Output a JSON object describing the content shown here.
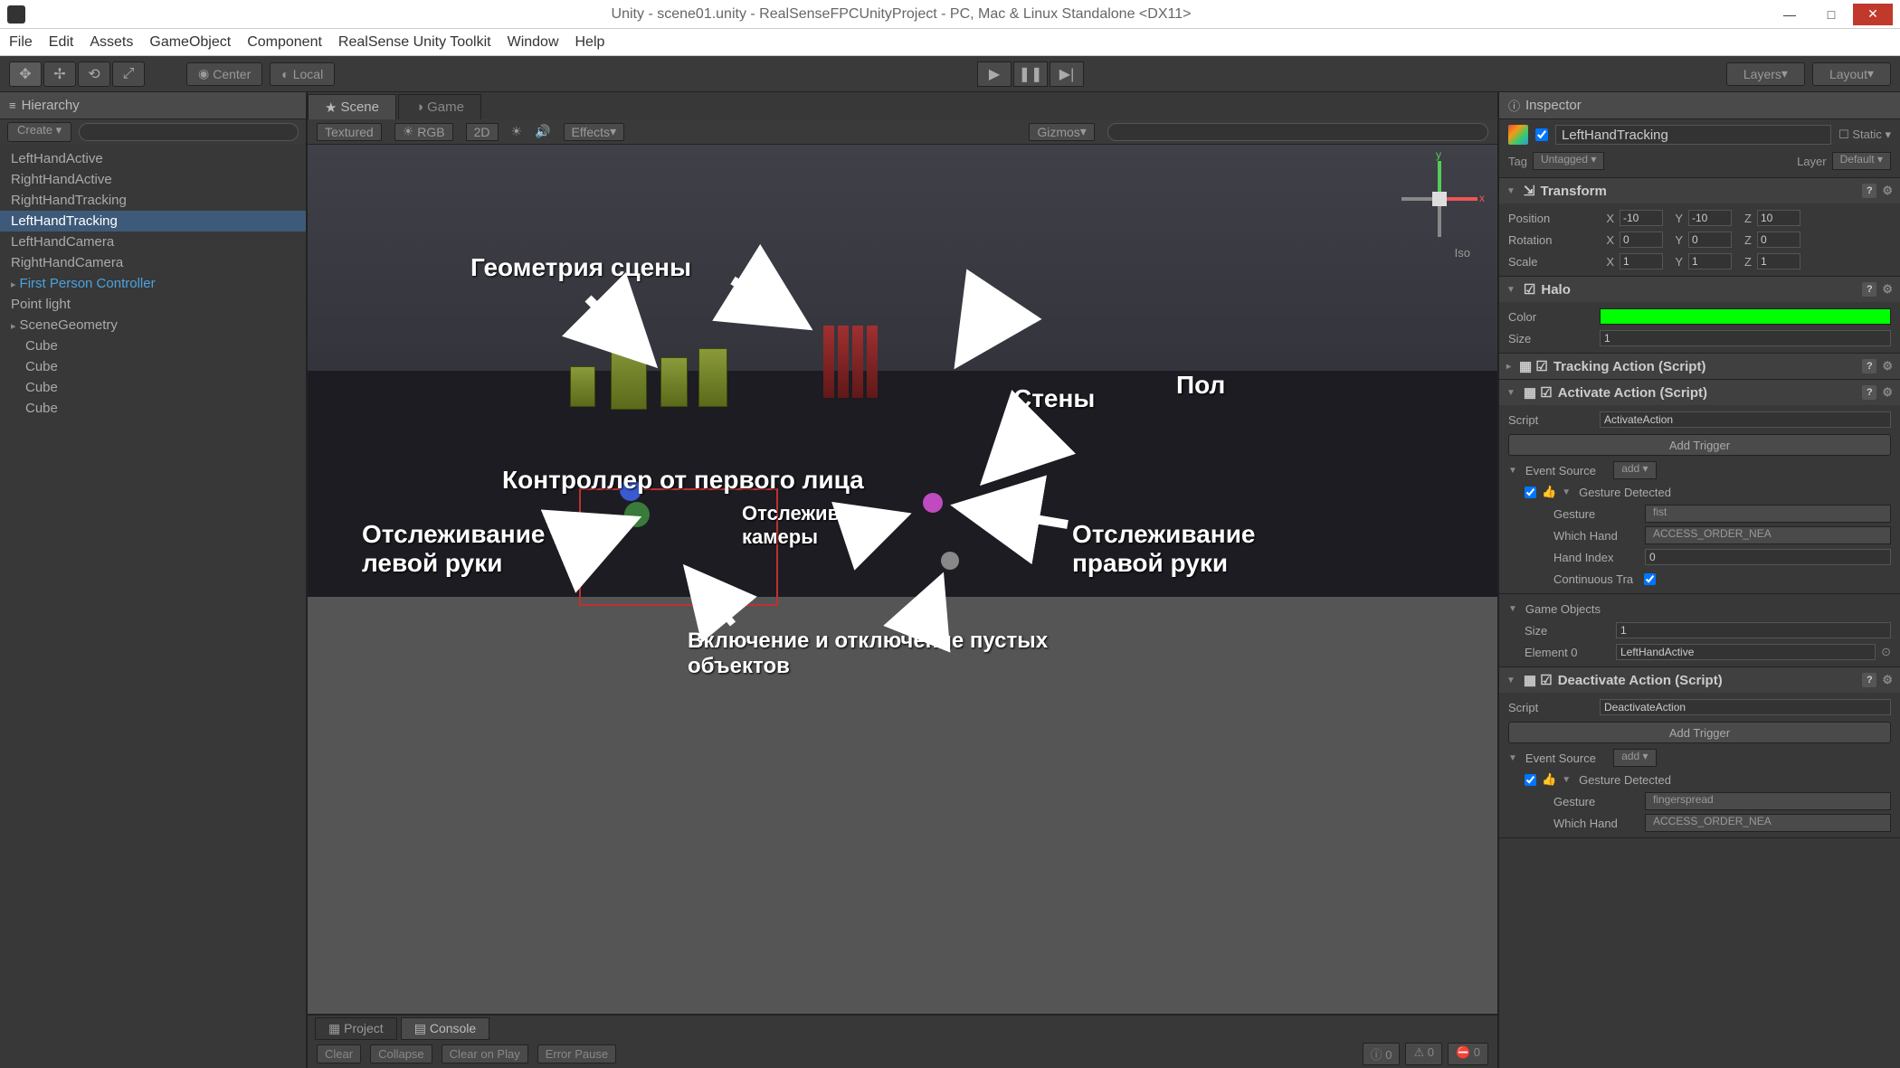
{
  "window": {
    "title": "Unity - scene01.unity - RealSenseFPCUnityProject - PC, Mac & Linux Standalone <DX11>"
  },
  "menubar": [
    "File",
    "Edit",
    "Assets",
    "GameObject",
    "Component",
    "RealSense Unity Toolkit",
    "Window",
    "Help"
  ],
  "toolbar": {
    "pivot": "Center",
    "local": "Local",
    "layers": "Layers",
    "layout": "Layout"
  },
  "hierarchy": {
    "title": "Hierarchy",
    "create": "Create",
    "items": [
      {
        "label": "LeftHandActive",
        "sel": false,
        "blue": false,
        "expand": false,
        "indent": false
      },
      {
        "label": "RightHandActive",
        "sel": false,
        "blue": false,
        "expand": false,
        "indent": false
      },
      {
        "label": "RightHandTracking",
        "sel": false,
        "blue": false,
        "expand": false,
        "indent": false
      },
      {
        "label": "LeftHandTracking",
        "sel": true,
        "blue": false,
        "expand": false,
        "indent": false
      },
      {
        "label": "LeftHandCamera",
        "sel": false,
        "blue": false,
        "expand": false,
        "indent": false
      },
      {
        "label": "RightHandCamera",
        "sel": false,
        "blue": false,
        "expand": false,
        "indent": false
      },
      {
        "label": "First Person Controller",
        "sel": false,
        "blue": true,
        "expand": true,
        "indent": false
      },
      {
        "label": "Point light",
        "sel": false,
        "blue": false,
        "expand": false,
        "indent": false
      },
      {
        "label": "SceneGeometry",
        "sel": false,
        "blue": false,
        "expand": true,
        "indent": false
      },
      {
        "label": "Cube",
        "sel": false,
        "blue": false,
        "expand": false,
        "indent": true
      },
      {
        "label": "Cube",
        "sel": false,
        "blue": false,
        "expand": false,
        "indent": true
      },
      {
        "label": "Cube",
        "sel": false,
        "blue": false,
        "expand": false,
        "indent": true
      },
      {
        "label": "Cube",
        "sel": false,
        "blue": false,
        "expand": false,
        "indent": true
      }
    ]
  },
  "scene": {
    "tab_scene": "Scene",
    "tab_game": "Game",
    "shading": "Textured",
    "render": "RGB",
    "twod": "2D",
    "effects": "Effects",
    "gizmos": "Gizmos",
    "iso": "Iso"
  },
  "annotations": {
    "geometry": "Геометрия сцены",
    "walls": "Стены",
    "floor": "Пол",
    "fpc": "Контроллер от первого лица",
    "left_hand": "Отслеживание левой руки",
    "right_hand": "Отслеживание правой руки",
    "camera": "Отслеживание камеры",
    "toggle": "Включение и отключение пустых объектов"
  },
  "bottom": {
    "project": "Project",
    "console": "Console",
    "clear": "Clear",
    "collapse": "Collapse",
    "clear_on_play": "Clear on Play",
    "error_pause": "Error Pause",
    "count0": "0",
    "count1": "0",
    "count2": "0"
  },
  "inspector": {
    "title": "Inspector",
    "go_name": "LeftHandTracking",
    "static": "Static",
    "tag_label": "Tag",
    "tag_value": "Untagged",
    "layer_label": "Layer",
    "layer_value": "Default",
    "transform": {
      "title": "Transform",
      "position": "Position",
      "px": "-10",
      "py": "-10",
      "pz": "10",
      "rotation": "Rotation",
      "rx": "0",
      "ry": "0",
      "rz": "0",
      "scale": "Scale",
      "sx": "1",
      "sy": "1",
      "sz": "1"
    },
    "halo": {
      "title": "Halo",
      "color_label": "Color",
      "size_label": "Size",
      "size_value": "1"
    },
    "tracking": {
      "title": "Tracking Action (Script)"
    },
    "activate": {
      "title": "Activate Action (Script)",
      "script_label": "Script",
      "script_value": "ActivateAction",
      "add_trigger": "Add Trigger",
      "event_source": "Event Source",
      "add": "add",
      "gesture_detected": "Gesture Detected",
      "gesture_label": "Gesture",
      "gesture_value": "fist",
      "which_hand_label": "Which Hand",
      "which_hand_value": "ACCESS_ORDER_NEA",
      "hand_index_label": "Hand Index",
      "hand_index_value": "0",
      "continuous_label": "Continuous Tra"
    },
    "game_objects": {
      "title": "Game Objects",
      "size_label": "Size",
      "size_value": "1",
      "element_label": "Element 0",
      "element_value": "LeftHandActive"
    },
    "deactivate": {
      "title": "Deactivate Action (Script)",
      "script_label": "Script",
      "script_value": "DeactivateAction",
      "add_trigger": "Add Trigger",
      "event_source": "Event Source",
      "add": "add",
      "gesture_detected": "Gesture Detected",
      "gesture_label": "Gesture",
      "gesture_value": "fingerspread",
      "which_hand_label": "Which Hand",
      "which_hand_value": "ACCESS_ORDER_NEA"
    }
  }
}
